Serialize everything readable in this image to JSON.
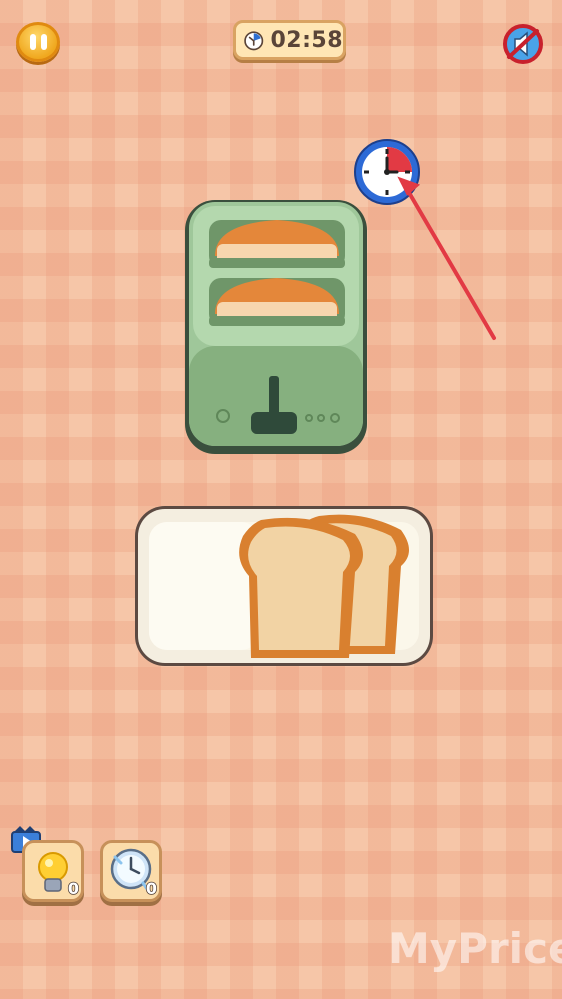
{
  "hud": {
    "timer_text": "02:58",
    "pause_icon": "pause-icon",
    "sound_icon": "sound-muted-icon"
  },
  "powerups": [
    {
      "name": "hint-lightbulb",
      "count": "0",
      "has_video_badge": true
    },
    {
      "name": "time-freeze-clock",
      "count": "0",
      "has_video_badge": false
    }
  ],
  "scene": {
    "toaster_slots": 2,
    "tray_items": "bread-slices",
    "bread_on_tray": 2
  },
  "watermark": "MyPrice",
  "colors": {
    "background": "#f6c6a8",
    "toaster": "#9fc79a",
    "arrow": "#e23a44",
    "timer_bg": "#ffe6b5",
    "button_gold": "#f0a81f"
  }
}
